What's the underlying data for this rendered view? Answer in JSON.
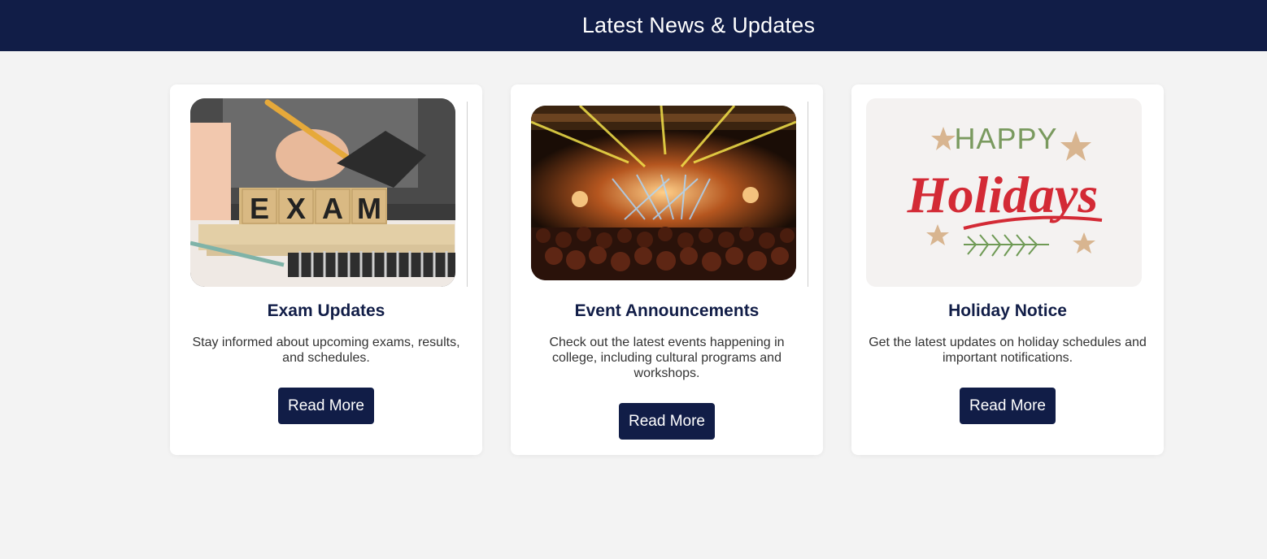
{
  "header": {
    "title": "Latest News & Updates"
  },
  "cards": [
    {
      "title": "Exam Updates",
      "description": "Stay informed about upcoming exams, results, and schedules.",
      "button_label": "Read More",
      "image": {
        "alt": "exam-image",
        "tile_letters": [
          "E",
          "X",
          "A",
          "M"
        ]
      }
    },
    {
      "title": "Event Announcements",
      "description": "Check out the latest events happening in college, including cultural programs and workshops.",
      "button_label": "Read More",
      "image": {
        "alt": "concert-image"
      }
    },
    {
      "title": "Holiday Notice",
      "description": "Get the latest updates on holiday schedules and important notifications.",
      "button_label": "Read More",
      "image": {
        "alt": "holidays-image",
        "line1": "HAPPY",
        "line2": "Holidays"
      }
    }
  ],
  "colors": {
    "header_bg": "#111d47",
    "page_bg": "#f3f3f3",
    "button_bg": "#111d47",
    "title_color": "#111d47"
  }
}
